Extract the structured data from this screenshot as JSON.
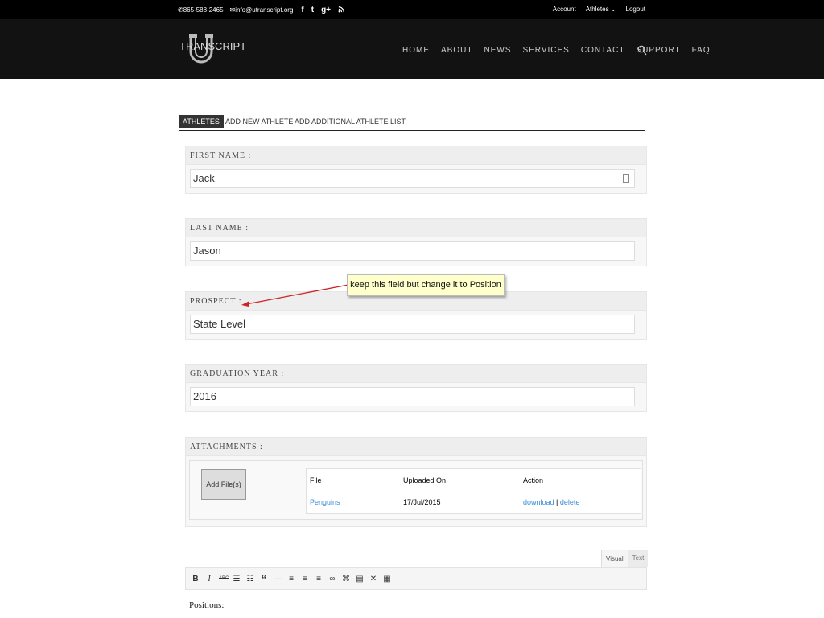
{
  "topbar": {
    "phone": "865-588-2465",
    "email": "info@utranscript.org",
    "account": "Account",
    "athletes": "Athletes",
    "logout": "Logout"
  },
  "header": {
    "logo_text": "TRANSCRIPT",
    "nav": [
      "HOME",
      "ABOUT",
      "NEWS",
      "SERVICES",
      "CONTACT",
      "SUPPORT",
      "FAQ"
    ]
  },
  "tabs": [
    "ATHLETES",
    "ADD NEW ATHLETE",
    "ADD ADDITIONAL ATHLETE LIST"
  ],
  "fields": {
    "first_name": {
      "label": "FIRST NAME :",
      "value": "Jack"
    },
    "last_name": {
      "label": "LAST NAME :",
      "value": "Jason"
    },
    "prospect": {
      "label": "PROSPECT :",
      "value": "State Level"
    },
    "graduation_year": {
      "label": "GRADUATION YEAR :",
      "value": "2016"
    }
  },
  "callout": {
    "text": "keep this field but change it to Position"
  },
  "attachments": {
    "label": "ATTACHMENTS :",
    "add_button": "Add File(s)",
    "columns": [
      "File",
      "Uploaded On",
      "Action"
    ],
    "rows": [
      {
        "file": "Penguins",
        "uploaded": "17/Jul/2015",
        "download": "download",
        "sep": "|",
        "delete": "delete"
      }
    ]
  },
  "editor": {
    "visual_tab": "Visual",
    "text_tab": "Text",
    "content": "Positions:"
  },
  "colors": {
    "link": "#3b8dd6",
    "callout_bg": "#ffffcc",
    "arrow": "#cc2222",
    "header_bg": "#121212"
  }
}
